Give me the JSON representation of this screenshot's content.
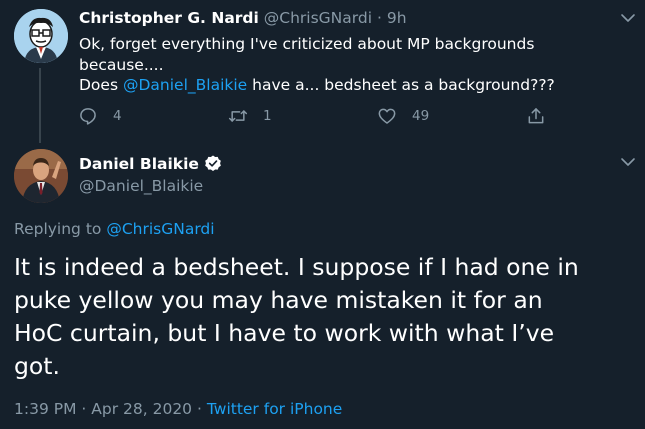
{
  "parent_tweet": {
    "name": "Christopher G. Nardi",
    "handle": "@ChrisGNardi",
    "separator": "·",
    "time": "9h",
    "text_lines": [
      [
        {
          "t": "Ok, forget everything I've criticized about MP backgrounds"
        }
      ],
      [
        {
          "t": "because...."
        }
      ],
      [
        {
          "t": "Does "
        },
        {
          "t": "@Daniel_Blaikie",
          "mention": true
        },
        {
          "t": " have a... bedsheet as a background???"
        }
      ]
    ],
    "reply_count": "4",
    "retweet_count": "1",
    "like_count": "49"
  },
  "reply_tweet": {
    "name": "Daniel Blaikie",
    "handle": "@Daniel_Blaikie",
    "verified": true,
    "replying_prefix": "Replying to ",
    "replying_to": "@ChrisGNardi",
    "text_lines": [
      "It is indeed a bedsheet. I suppose if I had one in",
      "puke yellow you may have mistaken it for an",
      "HoC curtain, but I have to work with what I’ve",
      "got."
    ],
    "time": "1:39 PM",
    "date": "Apr 28, 2020",
    "meta_separator": "·",
    "source": "Twitter for iPhone"
  },
  "colors": {
    "background": "#15202b",
    "text_primary": "#ffffff",
    "text_secondary": "#8899a6",
    "accent": "#1da1f2",
    "divider": "#38444d"
  },
  "icons": [
    "reply-icon",
    "retweet-icon",
    "like-icon",
    "share-icon",
    "chevron-down-icon",
    "verified-badge-icon"
  ]
}
